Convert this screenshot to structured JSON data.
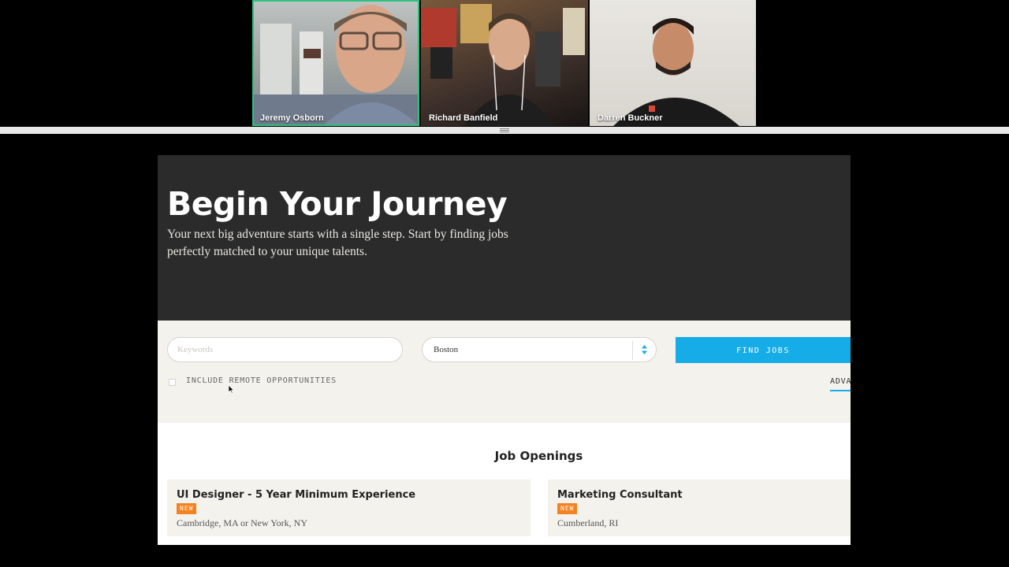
{
  "participants": [
    {
      "name": "Jeremy Osborn",
      "active": true
    },
    {
      "name": "Richard Banfield",
      "active": false
    },
    {
      "name": "Darren Buckner",
      "active": false
    }
  ],
  "hero": {
    "title": "Begin Your Journey",
    "subtitle": "Your next big adventure starts with a single step. Start by finding jobs perfectly matched to your unique talents."
  },
  "search": {
    "keywords_placeholder": "Keywords",
    "keywords_value": "",
    "location_value": "Boston",
    "find_button": "FIND JOBS",
    "remote_label": "INCLUDE REMOTE OPPORTUNITIES",
    "remote_checked": false,
    "advanced_label": "ADVA"
  },
  "jobs": {
    "title": "Job Openings",
    "items": [
      {
        "title": "UI Designer - 5 Year Minimum Experience",
        "badge": "NEW",
        "location": "Cambridge, MA or New York, NY"
      },
      {
        "title": "Marketing Consultant",
        "badge": "NEW",
        "location": "Cumberland, RI"
      }
    ]
  },
  "colors": {
    "active_speaker": "#2ec27e",
    "accent_button": "#15ace8",
    "badge": "#f58220",
    "hero_bg": "#2b2b2c"
  }
}
